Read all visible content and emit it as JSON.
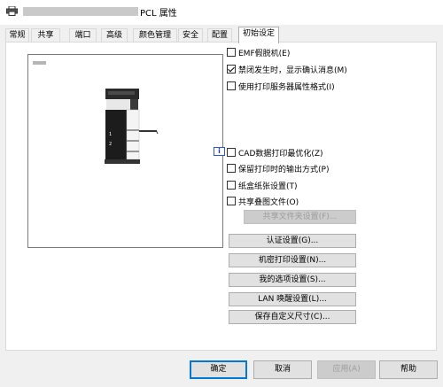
{
  "window": {
    "title": "PCL 属性"
  },
  "tabs": [
    {
      "label": "常规"
    },
    {
      "label": "共享"
    },
    {
      "label": "端口"
    },
    {
      "label": "高级"
    },
    {
      "label": "颜色管理"
    },
    {
      "label": "安全"
    },
    {
      "label": "配置"
    },
    {
      "label": "初始设定"
    }
  ],
  "active_tab": "初始设定",
  "options": {
    "emf": {
      "label": "EMF假脱机(E)",
      "checked": false
    },
    "suppress_error": {
      "label": "禁闭发生时，显示确认消息(M)",
      "checked": true
    },
    "server_format": {
      "label": "使用打印服务器属性格式(I)",
      "checked": false
    },
    "cad": {
      "label": "CAD数据打印最优化(Z)",
      "checked": false
    },
    "keep_output": {
      "label": "保留打印时的输出方式(P)",
      "checked": false
    },
    "tray_setting": {
      "label": "纸盒纸张设置(T)",
      "checked": false
    },
    "share_overlay": {
      "label": "共享叠图文件(O)",
      "checked": false
    }
  },
  "buttons": {
    "share_folder": "共享文件夹设置(F)...",
    "auth": "认证设置(G)...",
    "secure_print": "机密打印设置(N)...",
    "my_options": "我的选项设置(S)...",
    "lan_wakeup": "LAN 唤醒设置(L)...",
    "custom_size": "保存自定义尺寸(C)..."
  },
  "footer": {
    "ok": "确定",
    "cancel": "取消",
    "apply": "应用(A)",
    "help": "帮助"
  },
  "icons": {
    "title": "printer-icon",
    "info": "info-icon"
  },
  "colors": {
    "accent": "#0078d7",
    "info_blue": "#1a3fc2"
  }
}
